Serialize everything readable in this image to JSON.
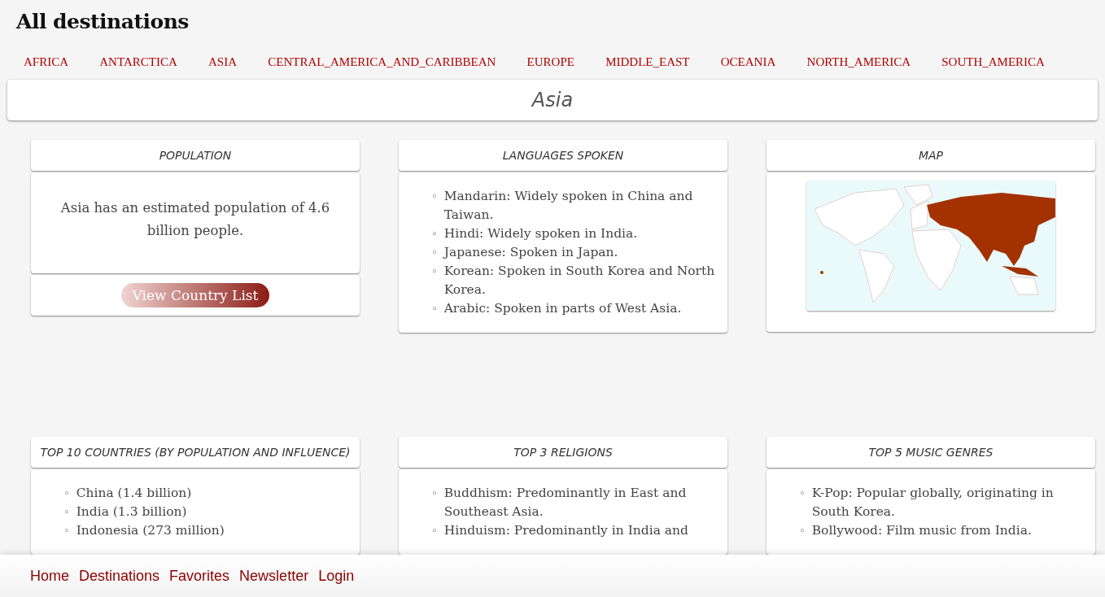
{
  "page_title": "All destinations",
  "regions": [
    "AFRICA",
    "ANTARCTICA",
    "ASIA",
    "CENTRAL_AMERICA_AND_CARIBBEAN",
    "EUROPE",
    "MIDDLE_EAST",
    "OCEANIA",
    "NORTH_AMERICA",
    "SOUTH_AMERICA"
  ],
  "region_heading": "Asia",
  "cards": [
    {
      "kind": "text",
      "title": "POPULATION",
      "text": "Asia has an estimated population of 4.6 billion people.",
      "button": "View Country List"
    },
    {
      "kind": "list",
      "title": "LANGUAGES SPOKEN",
      "items": [
        {
          "marker": "◦",
          "text": "Mandarin: Widely spoken in China and Taiwan."
        },
        {
          "marker": "◦",
          "text": "Hindi: Widely spoken in India."
        },
        {
          "marker": "◦",
          "text": "Japanese: Spoken in Japan."
        },
        {
          "marker": "◦",
          "text": "Korean: Spoken in South Korea and North Korea."
        },
        {
          "marker": "◦",
          "text": "Arabic: Spoken in parts of West Asia."
        }
      ]
    },
    {
      "kind": "map",
      "title": "MAP"
    },
    {
      "kind": "list",
      "title": "TOP 10 COUNTRIES (BY POPULATION AND INFLUENCE)",
      "items": [
        {
          "marker": "◦",
          "text": "China (1.4 billion)"
        },
        {
          "marker": "◦",
          "text": "India (1.3 billion)"
        },
        {
          "marker": "◦",
          "text": "Indonesia (273 million)"
        }
      ]
    },
    {
      "kind": "list",
      "title": "TOP 3 RELIGIONS",
      "items": [
        {
          "marker": "◦",
          "text": "Buddhism: Predominantly in East and Southeast Asia."
        },
        {
          "marker": "◦",
          "text": "Hinduism: Predominantly in India and"
        }
      ]
    },
    {
      "kind": "list",
      "title": "TOP 5 MUSIC GENRES",
      "items": [
        {
          "marker": "◦",
          "text": "K-Pop: Popular globally, originating in South Korea."
        },
        {
          "marker": "◦",
          "text": "Bollywood: Film music from India."
        }
      ]
    }
  ],
  "footer_links": [
    "Home",
    "Destinations",
    "Favorites",
    "Newsletter",
    "Login"
  ]
}
